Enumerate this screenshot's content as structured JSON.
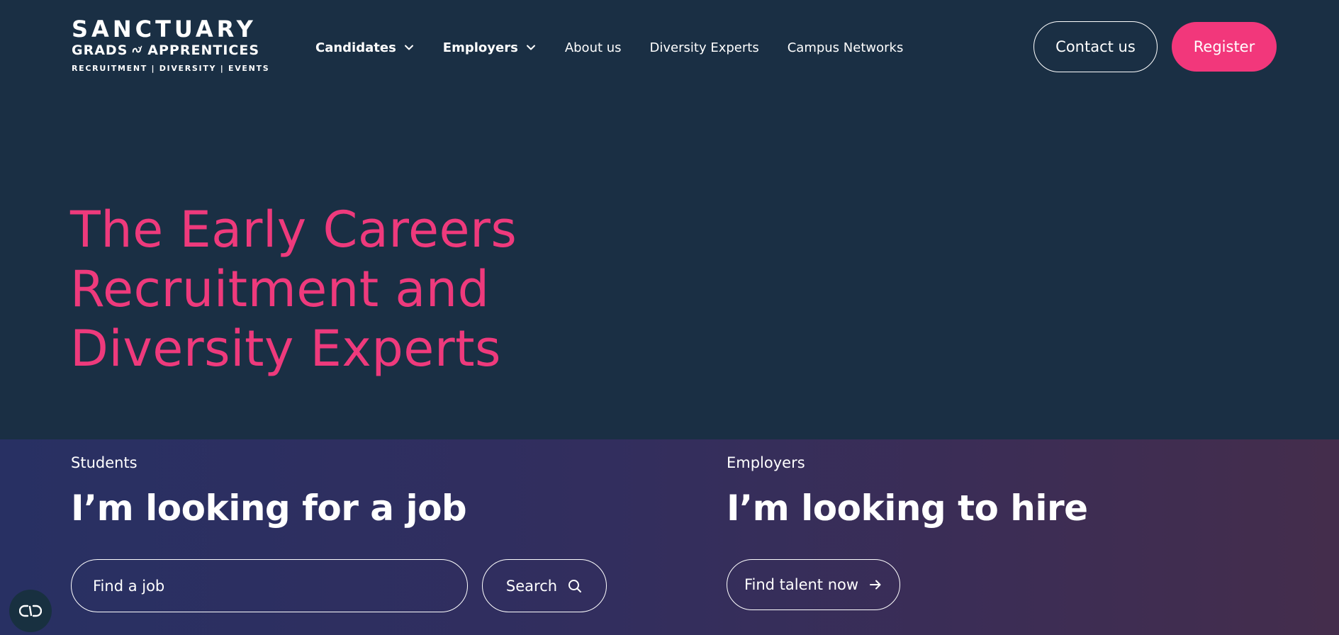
{
  "logo": {
    "line1": "SANCTUARY",
    "line2_left": "GRADS",
    "line2_right": "APPRENTICES",
    "line3": "RECRUITMENT | DIVERSITY | EVENTS"
  },
  "nav": {
    "items": [
      {
        "label": "Candidates",
        "has_dropdown": true
      },
      {
        "label": "Employers",
        "has_dropdown": true
      },
      {
        "label": "About us",
        "has_dropdown": false
      },
      {
        "label": "Diversity Experts",
        "has_dropdown": false
      },
      {
        "label": "Campus Networks",
        "has_dropdown": false
      }
    ]
  },
  "header_actions": {
    "contact_label": "Contact us",
    "register_label": "Register"
  },
  "hero": {
    "title_line1": "The Early Careers",
    "title_line2": "Recruitment and",
    "title_line3": "Diversity Experts"
  },
  "students": {
    "eyebrow": "Students",
    "heading": "I’m looking for a job",
    "search_placeholder": "Find a job",
    "search_button_label": "Search"
  },
  "employers": {
    "eyebrow": "Employers",
    "heading": "I’m looking to hire",
    "cta_label": "Find talent now"
  },
  "colors": {
    "background_top": "#1a2f44",
    "accent_pink": "#f2377b",
    "gradient_start": "#283063",
    "gradient_end": "#442d4c"
  },
  "icons": {
    "dropdown": "chevron-down-icon",
    "search": "search-icon",
    "arrow": "arrow-right-icon",
    "accessibility": "accessibility-icon"
  }
}
